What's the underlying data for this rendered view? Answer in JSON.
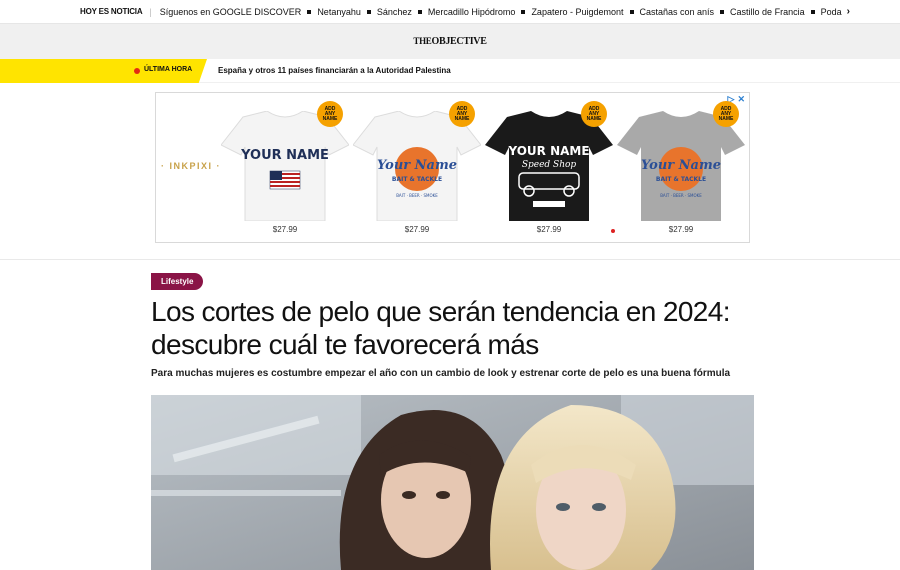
{
  "topbar": {
    "lead": "HOY ES NOTICIA",
    "items": [
      "Síguenos en GOOGLE DISCOVER",
      "Netanyahu",
      "Sánchez",
      "Mercadillo Hipódromo",
      "Zapatero - Puigdemont",
      "Castañas con anís",
      "Castillo de Francia",
      "Poda"
    ],
    "more_icon": "chevron-right-icon"
  },
  "logo": {
    "the": "THE",
    "objective": "OBJECTIVE"
  },
  "breaking": {
    "label": "ÚLTIMA HORA",
    "headline": "España y otros 11 países financiarán a la Autoridad Palestina"
  },
  "ad": {
    "brand": "INKPIXI",
    "badge_text": [
      "ADD",
      "ANY",
      "NAME"
    ],
    "products": [
      {
        "name_line": "YOUR NAME",
        "sub": "",
        "price": "$27.99",
        "shirt_color": "#f4f4f4",
        "ink": "#1f2f57"
      },
      {
        "name_line": "Your Name",
        "sub": "BAIT & TACKLE",
        "price": "$27.99",
        "shirt_color": "#f4f4f4",
        "ink": "#2b4f96"
      },
      {
        "name_line": "YOUR NAME",
        "sub": "Speed Shop",
        "price": "$27.99",
        "shirt_color": "#1a1a1a",
        "ink": "#ffffff"
      },
      {
        "name_line": "Your Name",
        "sub": "BAIT & TACKLE",
        "price": "$27.99",
        "shirt_color": "#a9a9a9",
        "ink": "#2b4f96"
      }
    ],
    "choices_icons": [
      "adchoices-icon",
      "close-icon"
    ]
  },
  "article": {
    "section": "Lifestyle",
    "title": "Los cortes de pelo que serán tendencia en 2024: descubre cuál te favorecerá más",
    "subtitle": "Para muchas mujeres es costumbre empezar el año con un cambio de look y estrenar corte de pelo es una buena fórmula"
  },
  "colors": {
    "breaking_yellow": "#ffe400",
    "breaking_dot": "#e32b12",
    "section_tag": "#8a1446",
    "ad_badge": "#f5a100"
  }
}
